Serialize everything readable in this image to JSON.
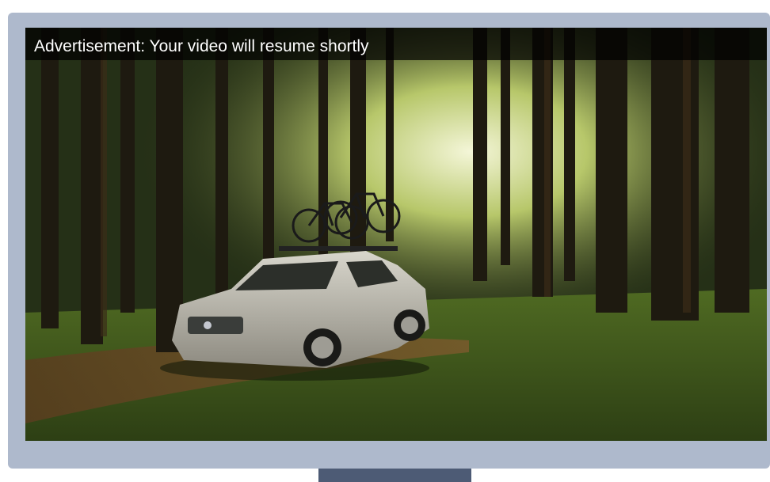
{
  "ad": {
    "banner_text": "Advertisement: Your video will resume shortly"
  },
  "video": {
    "subject": "silver station wagon with two bicycles on roof rack driving on forest dirt road"
  },
  "colors": {
    "frame": "#aeb9cc",
    "stand": "#4d5b75",
    "banner": "#000000"
  }
}
